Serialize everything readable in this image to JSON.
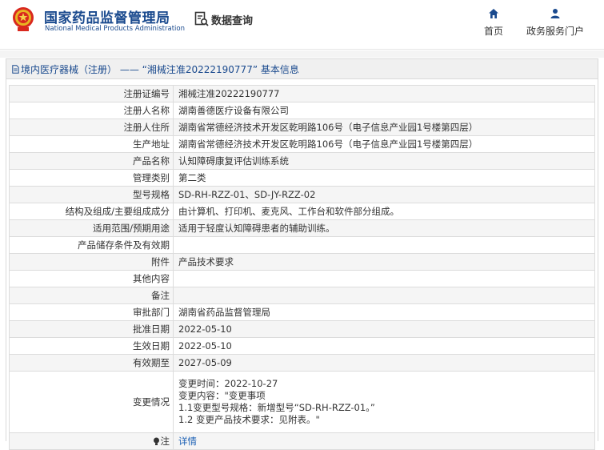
{
  "header": {
    "brand_cn": "国家药品监督管理局",
    "brand_en": "National Medical Products Administration",
    "data_query": "数据查询",
    "nav": [
      {
        "label": "首页",
        "icon": "home-icon"
      },
      {
        "label": "政务服务门户",
        "icon": "user-icon"
      }
    ]
  },
  "panel": {
    "title": "境内医疗器械（注册） —— “湘械注准20222190777” 基本信息"
  },
  "rows": [
    {
      "key": "注册证编号",
      "value": "湘械注准20222190777"
    },
    {
      "key": "注册人名称",
      "value": "湖南善德医疗设备有限公司"
    },
    {
      "key": "注册人住所",
      "value": "湖南省常德经济技术开发区乾明路106号（电子信息产业园1号楼第四层）"
    },
    {
      "key": "生产地址",
      "value": "湖南省常德经济技术开发区乾明路106号（电子信息产业园1号楼第四层）"
    },
    {
      "key": "产品名称",
      "value": "认知障碍康复评估训练系统"
    },
    {
      "key": "管理类别",
      "value": "第二类"
    },
    {
      "key": "型号规格",
      "value": "SD-RH-RZZ-01、SD-JY-RZZ-02"
    },
    {
      "key": "结构及组成/主要组成成分",
      "value": "由计算机、打印机、麦克风、工作台和软件部分组成。"
    },
    {
      "key": "适用范围/预期用途",
      "value": "适用于轻度认知障碍患者的辅助训练。"
    },
    {
      "key": "产品储存条件及有效期",
      "value": ""
    },
    {
      "key": "附件",
      "value": "产品技术要求"
    },
    {
      "key": "其他内容",
      "value": ""
    },
    {
      "key": "备注",
      "value": ""
    },
    {
      "key": "审批部门",
      "value": "湖南省药品监督管理局"
    },
    {
      "key": "批准日期",
      "value": "2022-05-10"
    },
    {
      "key": "生效日期",
      "value": "2022-05-10"
    },
    {
      "key": "有效期至",
      "value": "2027-05-09"
    }
  ],
  "change": {
    "key": "变更情况",
    "lines": [
      "变更时间：2022-10-27",
      "变更内容：\"变更事项",
      "1.1变更型号规格：新增型号“SD-RH-RZZ-01。”",
      "1.2 变更产品技术要求：见附表。\""
    ]
  },
  "note": {
    "key": "注",
    "link": "详情"
  }
}
